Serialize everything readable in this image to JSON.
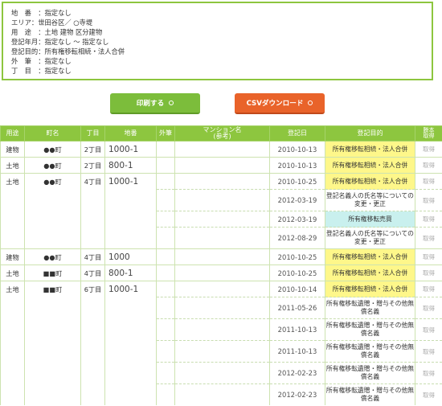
{
  "criteria": [
    "地　番　：指定なし",
    "エリア：世田谷区／ ○寺堤",
    "用　途　：土地 建物 区分建物",
    "登記年月：指定なし 〜 指定なし",
    "登記目的：所有権移転相続・法人合併",
    "外　筆　：指定なし",
    "丁　目　：指定なし"
  ],
  "buttons": {
    "print": "印刷する",
    "csv": "CSVダウンロード"
  },
  "table": {
    "headers": {
      "use": "用途",
      "town": "町名",
      "chome": "丁目",
      "chiban": "地番",
      "gaihitsu": "外筆",
      "mansion": "マンション名",
      "mansion_sub": "(参考)",
      "date": "登記日",
      "purpose": "登記目的",
      "last1": "謄本",
      "last2": "取得"
    },
    "rows": [
      {
        "use": "建物",
        "town": "●●町",
        "chome": "2丁目",
        "chiban": "1000-1",
        "date": "2010-10-13",
        "purpose": "所有権移転相続・法人合併",
        "link": "取得"
      },
      {
        "use": "土地",
        "town": "●●町",
        "chome": "2丁目",
        "chiban": "800-1",
        "date": "2010-10-13",
        "purpose": "所有権移転相続・法人合併",
        "link": "取得"
      },
      {
        "use": "土地",
        "town": "●●町",
        "chome": "4丁目",
        "chiban": "1000-1",
        "date": "2010-10-25",
        "purpose": "所有権移転相続・法人合併",
        "link": "取得"
      },
      {
        "use": "",
        "town": "",
        "chome": "",
        "chiban": "",
        "date": "2012-03-19",
        "purpose": "登記名義人の氏名等についての変更・更正",
        "link": "取得"
      },
      {
        "use": "",
        "town": "",
        "chome": "",
        "chiban": "",
        "date": "2012-03-19",
        "purpose": "所有権移転売買",
        "link": "取得"
      },
      {
        "use": "",
        "town": "",
        "chome": "",
        "chiban": "",
        "date": "2012-08-29",
        "purpose": "登記名義人の氏名等についての変更・更正",
        "link": "取得"
      },
      {
        "use": "建物",
        "town": "●●町",
        "chome": "4丁目",
        "chiban": "1000",
        "date": "2010-10-25",
        "purpose": "所有権移転相続・法人合併",
        "link": "取得"
      },
      {
        "use": "土地",
        "town": "■■町",
        "chome": "4丁目",
        "chiban": "800-1",
        "date": "2010-10-25",
        "purpose": "所有権移転相続・法人合併",
        "link": "取得"
      },
      {
        "use": "土地",
        "town": "■■町",
        "chome": "6丁目",
        "chiban": "1000-1",
        "date": "2010-10-14",
        "purpose": "所有権移転相続・法人合併",
        "link": "取得"
      },
      {
        "use": "",
        "town": "",
        "chome": "",
        "chiban": "",
        "date": "2011-05-26",
        "purpose": "所有権移転遺贈・贈与その他無償名義",
        "link": "取得"
      },
      {
        "use": "",
        "town": "",
        "chome": "",
        "chiban": "",
        "date": "2011-10-13",
        "purpose": "所有権移転遺贈・贈与その他無償名義",
        "link": "取得"
      },
      {
        "use": "",
        "town": "",
        "chome": "",
        "chiban": "",
        "date": "2011-10-13",
        "purpose": "所有権移転遺贈・贈与その他無償名義",
        "link": "取得"
      },
      {
        "use": "",
        "town": "",
        "chome": "",
        "chiban": "",
        "date": "2012-02-23",
        "purpose": "所有権移転遺贈・贈与その他無償名義",
        "link": "取得"
      },
      {
        "use": "",
        "town": "",
        "chome": "",
        "chiban": "",
        "date": "2012-02-23",
        "purpose": "所有権移転遺贈・贈与その他無償名義",
        "link": "取得"
      }
    ]
  },
  "colors": {
    "header_green": "#8dc63f",
    "print_button": "#7cbd3b",
    "csv_button": "#e9632a",
    "highlight_yellow": "#fef78a",
    "highlight_cyan": "#c9f0ee"
  }
}
